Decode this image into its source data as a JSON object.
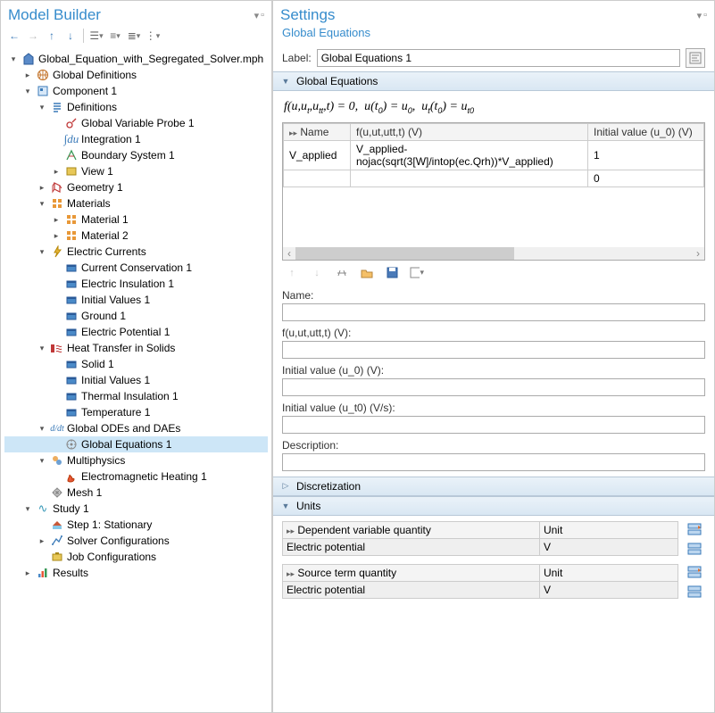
{
  "left": {
    "title": "Model Builder",
    "tree": [
      {
        "d": 0,
        "tw": "▿",
        "ic": "root",
        "label": "Global_Equation_with_Segregated_Solver.mph"
      },
      {
        "d": 1,
        "tw": "▹",
        "ic": "globe",
        "label": "Global Definitions"
      },
      {
        "d": 1,
        "tw": "▿",
        "ic": "comp",
        "label": "Component 1"
      },
      {
        "d": 2,
        "tw": "▿",
        "ic": "defs",
        "label": "Definitions"
      },
      {
        "d": 3,
        "tw": "",
        "ic": "probe",
        "label": "Global Variable Probe 1"
      },
      {
        "d": 3,
        "tw": "",
        "ic": "integ",
        "label": "Integration 1"
      },
      {
        "d": 3,
        "tw": "",
        "ic": "bsys",
        "label": "Boundary System 1"
      },
      {
        "d": 3,
        "tw": "▹",
        "ic": "view",
        "label": "View 1"
      },
      {
        "d": 2,
        "tw": "▹",
        "ic": "geom",
        "label": "Geometry 1"
      },
      {
        "d": 2,
        "tw": "▿",
        "ic": "mats",
        "label": "Materials"
      },
      {
        "d": 3,
        "tw": "▹",
        "ic": "mat",
        "label": "Material 1"
      },
      {
        "d": 3,
        "tw": "▹",
        "ic": "mat",
        "label": "Material 2"
      },
      {
        "d": 2,
        "tw": "▿",
        "ic": "ec",
        "label": "Electric Currents"
      },
      {
        "d": 3,
        "tw": "",
        "ic": "phys",
        "label": "Current Conservation 1"
      },
      {
        "d": 3,
        "tw": "",
        "ic": "phys",
        "label": "Electric Insulation 1"
      },
      {
        "d": 3,
        "tw": "",
        "ic": "phys",
        "label": "Initial Values 1"
      },
      {
        "d": 3,
        "tw": "",
        "ic": "phys",
        "label": "Ground 1"
      },
      {
        "d": 3,
        "tw": "",
        "ic": "phys",
        "label": "Electric Potential 1"
      },
      {
        "d": 2,
        "tw": "▿",
        "ic": "ht",
        "label": "Heat Transfer in Solids"
      },
      {
        "d": 3,
        "tw": "",
        "ic": "phys",
        "label": "Solid 1"
      },
      {
        "d": 3,
        "tw": "",
        "ic": "phys",
        "label": "Initial Values 1"
      },
      {
        "d": 3,
        "tw": "",
        "ic": "phys",
        "label": "Thermal Insulation 1"
      },
      {
        "d": 3,
        "tw": "",
        "ic": "phys",
        "label": "Temperature 1"
      },
      {
        "d": 2,
        "tw": "▿",
        "ic": "ode",
        "label": "Global ODEs and DAEs"
      },
      {
        "d": 3,
        "tw": "",
        "ic": "geq",
        "label": "Global Equations 1",
        "selected": true
      },
      {
        "d": 2,
        "tw": "▿",
        "ic": "mphys",
        "label": "Multiphysics"
      },
      {
        "d": 3,
        "tw": "",
        "ic": "emh",
        "label": "Electromagnetic Heating 1"
      },
      {
        "d": 2,
        "tw": "",
        "ic": "mesh",
        "label": "Mesh 1"
      },
      {
        "d": 1,
        "tw": "▿",
        "ic": "study",
        "label": "Study 1"
      },
      {
        "d": 2,
        "tw": "",
        "ic": "step",
        "label": "Step 1: Stationary"
      },
      {
        "d": 2,
        "tw": "▹",
        "ic": "solver",
        "label": "Solver Configurations"
      },
      {
        "d": 2,
        "tw": "",
        "ic": "job",
        "label": "Job Configurations"
      },
      {
        "d": 1,
        "tw": "▹",
        "ic": "results",
        "label": "Results"
      }
    ]
  },
  "right": {
    "title": "Settings",
    "subtitle": "Global Equations",
    "label_field": "Label:",
    "label_value": "Global Equations 1",
    "sec_ge": "Global Equations",
    "formula_plain": "f(u,u_t,u_tt,t) = 0,  u(t_0) = u_0,  u_t(t_0) = u_t0",
    "tbl_headers": [
      "Name",
      "f(u,ut,utt,t) (V)",
      "Initial value (u_0) (V)"
    ],
    "tbl_rows": [
      {
        "name": "V_applied",
        "f": "V_applied-nojac(sqrt(3[W]/intop(ec.Qrh))*V_applied)",
        "iv": "1"
      },
      {
        "name": "",
        "f": "",
        "iv": "0"
      }
    ],
    "field_name": "Name:",
    "field_f": "f(u,ut,utt,t) (V):",
    "field_iv0": "Initial value (u_0) (V):",
    "field_ivt0": "Initial value (u_t0) (V/s):",
    "field_desc": "Description:",
    "sec_disc": "Discretization",
    "sec_units": "Units",
    "units_dv_header": "Dependent variable quantity",
    "units_unit_header": "Unit",
    "units_dv_val": "Electric potential",
    "units_dv_unit": "V",
    "units_st_header": "Source term quantity",
    "units_st_val": "Electric potential",
    "units_st_unit": "V"
  }
}
